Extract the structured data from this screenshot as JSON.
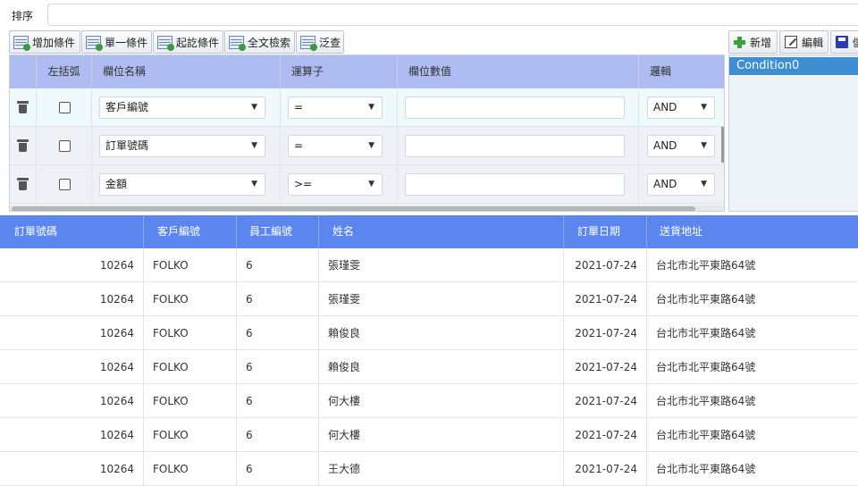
{
  "sort": {
    "label": "排序",
    "value": ""
  },
  "toolbar": {
    "add_condition": "增加條件",
    "single_condition": "單一條件",
    "range_condition": "起訖條件",
    "fulltext": "全文檢索",
    "fuzzy": "泛查"
  },
  "condition_grid": {
    "headers": {
      "paren": "左括弧",
      "field": "欄位名稱",
      "operator": "運算子",
      "value": "欄位數值",
      "logic": "邏輯"
    },
    "rows": [
      {
        "field": "客戶編號",
        "operator": "=",
        "value": "",
        "logic": "AND"
      },
      {
        "field": "訂單號碼",
        "operator": "=",
        "value": "",
        "logic": "AND"
      },
      {
        "field": "金額",
        "operator": ">=",
        "value": "",
        "logic": "AND"
      }
    ]
  },
  "right_panel": {
    "add_label": "新增",
    "edit_label": "編輯",
    "save_label": "儲",
    "items": [
      "Condition0"
    ]
  },
  "table": {
    "headers": {
      "order_no": "訂單號碼",
      "customer": "客戶編號",
      "employee": "員工編號",
      "name": "姓名",
      "date": "訂單日期",
      "address": "送貨地址"
    },
    "rows": [
      {
        "order_no": "10264",
        "customer": "FOLKO",
        "employee": "6",
        "name": "張瑾雯",
        "date": "2021-07-24",
        "address": "台北市北平東路64號"
      },
      {
        "order_no": "10264",
        "customer": "FOLKO",
        "employee": "6",
        "name": "張瑾雯",
        "date": "2021-07-24",
        "address": "台北市北平東路64號"
      },
      {
        "order_no": "10264",
        "customer": "FOLKO",
        "employee": "6",
        "name": "賴俊良",
        "date": "2021-07-24",
        "address": "台北市北平東路64號"
      },
      {
        "order_no": "10264",
        "customer": "FOLKO",
        "employee": "6",
        "name": "賴俊良",
        "date": "2021-07-24",
        "address": "台北市北平東路64號"
      },
      {
        "order_no": "10264",
        "customer": "FOLKO",
        "employee": "6",
        "name": "何大樓",
        "date": "2021-07-24",
        "address": "台北市北平東路64號"
      },
      {
        "order_no": "10264",
        "customer": "FOLKO",
        "employee": "6",
        "name": "何大樓",
        "date": "2021-07-24",
        "address": "台北市北平東路64號"
      },
      {
        "order_no": "10264",
        "customer": "FOLKO",
        "employee": "6",
        "name": "王大德",
        "date": "2021-07-24",
        "address": "台北市北平東路64號"
      }
    ]
  }
}
